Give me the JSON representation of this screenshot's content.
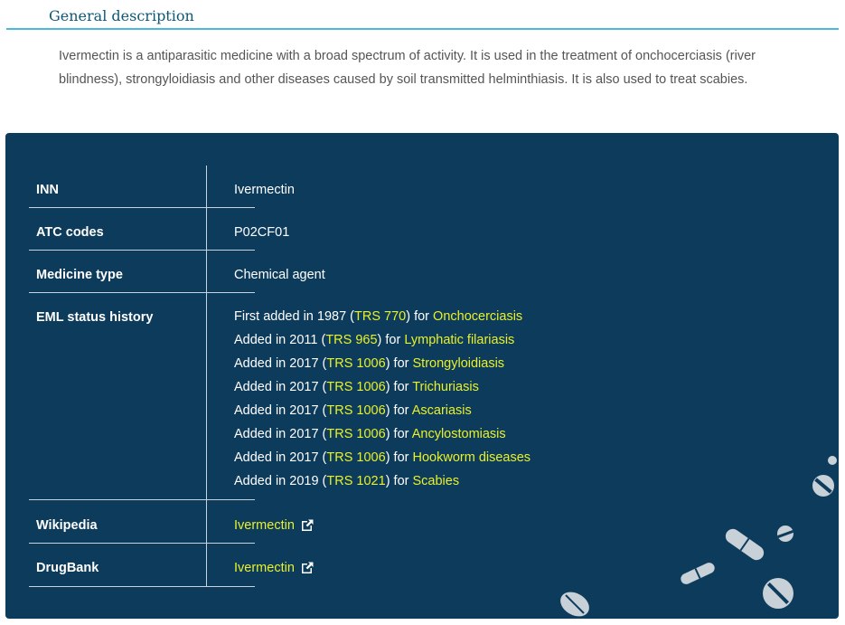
{
  "section": {
    "title": "General description"
  },
  "description": "Ivermectin is a antiparasitic medicine with a broad spectrum of activity. It is used in the treatment of onchocerciasis (river blindness), strongyloidiasis and other diseases caused by soil transmitted helminthiasis. It is also used to treat scabies.",
  "table": {
    "inn": {
      "label": "INN",
      "value": "Ivermectin"
    },
    "atc": {
      "label": "ATC codes",
      "value": "P02CF01"
    },
    "type": {
      "label": "Medicine type",
      "value": "Chemical agent"
    },
    "history": {
      "label": "EML status history",
      "entries": [
        {
          "prefix": "First added in 1987 (",
          "trs": "TRS 770",
          "mid": ") for ",
          "disease": "Onchocerciasis"
        },
        {
          "prefix": "Added in 2011 (",
          "trs": "TRS 965",
          "mid": ") for ",
          "disease": "Lymphatic filariasis"
        },
        {
          "prefix": "Added in 2017 (",
          "trs": "TRS 1006",
          "mid": ") for ",
          "disease": "Strongyloidiasis"
        },
        {
          "prefix": "Added in 2017 (",
          "trs": "TRS 1006",
          "mid": ") for ",
          "disease": "Trichuriasis"
        },
        {
          "prefix": "Added in 2017 (",
          "trs": "TRS 1006",
          "mid": ") for ",
          "disease": "Ascariasis"
        },
        {
          "prefix": "Added in 2017 (",
          "trs": "TRS 1006",
          "mid": ") for ",
          "disease": "Ancylostomiasis"
        },
        {
          "prefix": "Added in 2017 (",
          "trs": "TRS 1006",
          "mid": ") for ",
          "disease": "Hookworm diseases"
        },
        {
          "prefix": "Added in 2019 (",
          "trs": "TRS 1021",
          "mid": ") for ",
          "disease": "Scabies"
        }
      ]
    },
    "wikipedia": {
      "label": "Wikipedia",
      "link": "Ivermectin"
    },
    "drugbank": {
      "label": "DrugBank",
      "link": "Ivermectin"
    }
  },
  "colors": {
    "panel_bg": "#0d3b5c",
    "link": "#e8f12a",
    "heading": "#0e5877",
    "accent_rule": "#4ab7e0"
  },
  "icons": [
    "external-link-icon",
    "pill-icon"
  ]
}
